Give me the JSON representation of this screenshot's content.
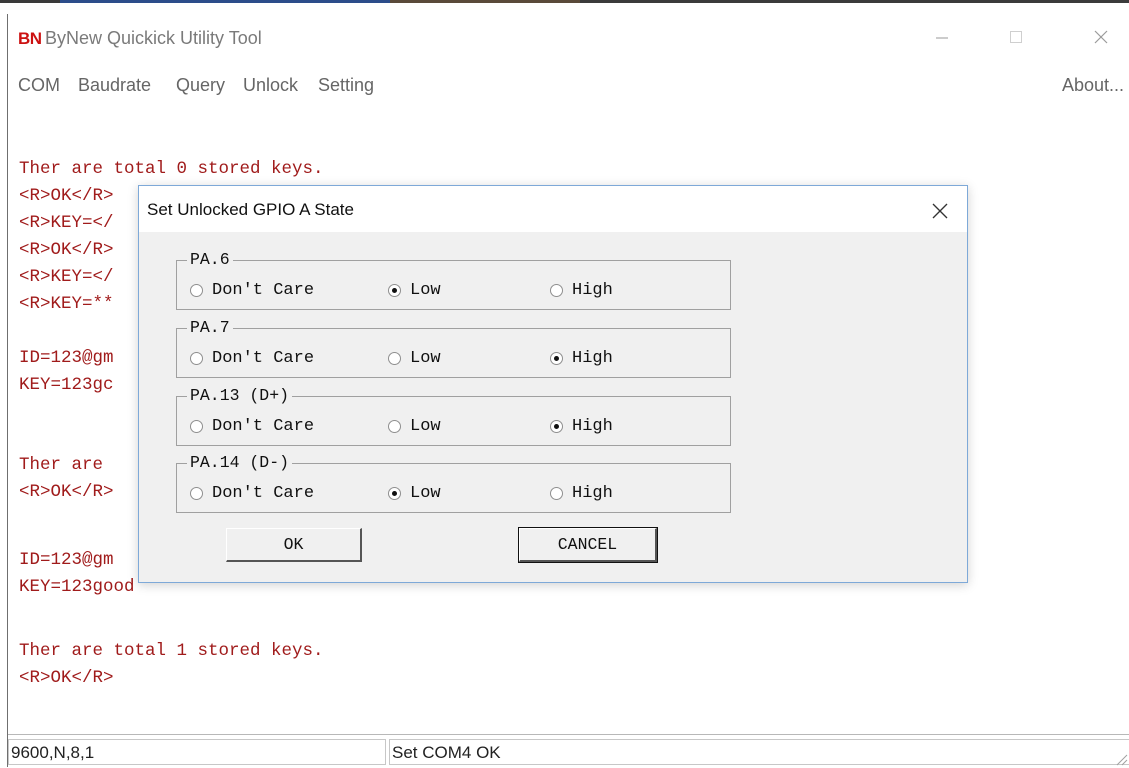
{
  "app": {
    "logo": "BN",
    "title": "ByNew Quickick Utility Tool"
  },
  "menu": {
    "items": [
      "COM",
      "Baudrate",
      "Query",
      "Unlock",
      "Setting"
    ],
    "about": "About..."
  },
  "console": {
    "lines": [
      "Ther are total 0 stored keys.",
      "<R>OK</R>",
      "<R>KEY=</",
      "<R>OK</R>",
      "<R>KEY=</",
      "<R>KEY=**",
      "",
      "ID=123@gm",
      "KEY=123gc",
      "",
      "Ther are",
      "<R>OK</R>",
      "",
      "ID=123@gm",
      "KEY=123good",
      "",
      "Ther are total 1 stored keys.",
      "<R>OK</R>"
    ]
  },
  "dialog": {
    "title": "Set Unlocked GPIO A State",
    "groups": [
      {
        "label": "PA.6",
        "options": [
          "Don't Care",
          "Low",
          "High"
        ],
        "selected": "Low"
      },
      {
        "label": "PA.7",
        "options": [
          "Don't Care",
          "Low",
          "High"
        ],
        "selected": "High"
      },
      {
        "label": "PA.13 (D+)",
        "options": [
          "Don't Care",
          "Low",
          "High"
        ],
        "selected": "High"
      },
      {
        "label": "PA.14 (D-)",
        "options": [
          "Don't Care",
          "Low",
          "High"
        ],
        "selected": "Low"
      }
    ],
    "ok_label": "OK",
    "cancel_label": "CANCEL"
  },
  "status": {
    "left": "9600,N,8,1",
    "right": "Set COM4 OK"
  },
  "colors": {
    "console_text": "#a01b1b",
    "logo": "#cc1111",
    "dialog_border": "#7ea9d8"
  }
}
